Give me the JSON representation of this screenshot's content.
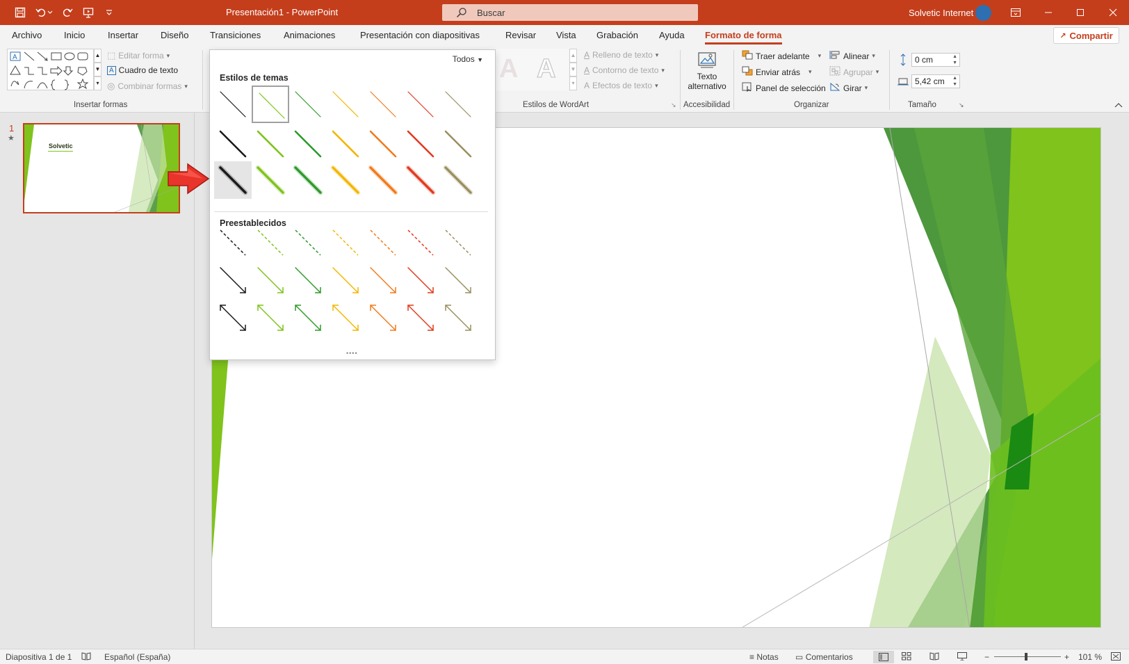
{
  "app": {
    "doc_title": "Presentación1 - PowerPoint",
    "search_placeholder": "Buscar",
    "user_name": "Solvetic Internet",
    "share_label": "Compartir"
  },
  "menu": {
    "tabs": [
      {
        "label": "Archivo"
      },
      {
        "label": "Inicio"
      },
      {
        "label": "Insertar"
      },
      {
        "label": "Diseño"
      },
      {
        "label": "Transiciones"
      },
      {
        "label": "Animaciones"
      },
      {
        "label": "Presentación con diapositivas"
      },
      {
        "label": "Revisar"
      },
      {
        "label": "Vista"
      },
      {
        "label": "Grabación"
      },
      {
        "label": "Ayuda"
      },
      {
        "label": "Formato de forma",
        "active": true
      }
    ]
  },
  "ribbon": {
    "insert_shapes": {
      "label": "Insertar formas",
      "edit_shape": "Editar forma",
      "text_box": "Cuadro de texto",
      "merge_shapes": "Combinar formas"
    },
    "wordart": {
      "label": "Estilos de WordArt",
      "text_fill": "Relleno de texto",
      "text_outline": "Contorno de texto",
      "text_effects": "Efectos de texto",
      "sample_letter": "A"
    },
    "accessibility": {
      "label": "Accesibilidad",
      "alt_text_line1": "Texto",
      "alt_text_line2": "alternativo"
    },
    "arrange": {
      "label": "Organizar",
      "bring_forward": "Traer adelante",
      "send_backward": "Enviar atrás",
      "selection_pane": "Panel de selección",
      "align": "Alinear",
      "group": "Agrupar",
      "rotate": "Girar"
    },
    "size": {
      "label": "Tamaño",
      "height": "0 cm",
      "width": "5,42 cm"
    }
  },
  "thumbnails": {
    "slide_number": "1",
    "star": "★",
    "thumb_title": "Solvetic"
  },
  "gallery": {
    "filter_label": "Todos",
    "theme_styles_heading": "Estilos de temas",
    "presets_heading": "Preestablecidos",
    "colors": [
      "#1a1a1a",
      "#7fc31c",
      "#2e9b2a",
      "#f2b600",
      "#f07b1c",
      "#e23a1e",
      "#9b8f60"
    ],
    "theme_rows": [
      "thin",
      "medium",
      "glow"
    ],
    "preset_rows": [
      "dashed",
      "arrow",
      "double-arrow"
    ],
    "selected": {
      "row": 0,
      "col": 1
    },
    "hovered": {
      "row": 2,
      "col": 0
    }
  },
  "statusbar": {
    "slide_info": "Diapositiva 1 de 1",
    "language": "Español (España)",
    "notes": "Notas",
    "comments": "Comentarios",
    "zoom": "101 %"
  }
}
